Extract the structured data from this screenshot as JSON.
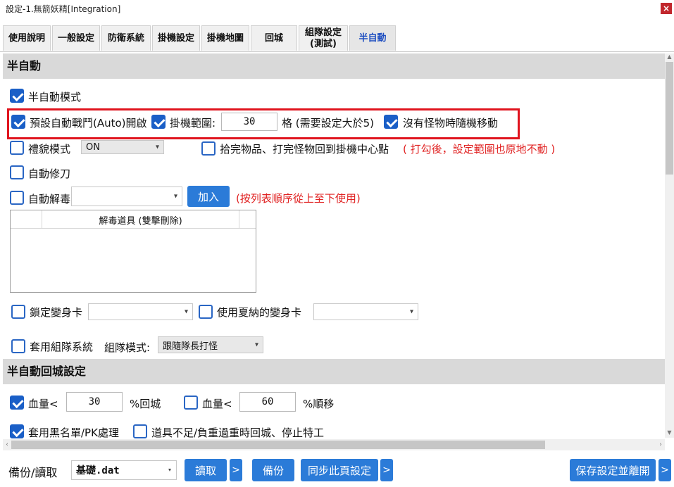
{
  "window": {
    "title": "設定-1.無箭妖精[Integration]",
    "close_icon": "close-icon"
  },
  "tabs": [
    {
      "label": "使用說明"
    },
    {
      "label": "一般設定"
    },
    {
      "label": "防衛系統"
    },
    {
      "label": "掛機設定"
    },
    {
      "label": "掛機地圖"
    },
    {
      "label": "回城"
    },
    {
      "label_line1": "組隊設定",
      "label_line2": "(測試)"
    },
    {
      "label": "半自動",
      "active": true
    }
  ],
  "section1": {
    "title": "半自動",
    "semi_auto_mode": {
      "label": "半自動模式",
      "checked": true
    },
    "auto_battle": {
      "label": "預設自動戰鬥(Auto)開啟",
      "checked": true
    },
    "range": {
      "label": "掛機範圍:",
      "checked": true,
      "value": "30",
      "hint": "格 (需要設定大於5)"
    },
    "random_move": {
      "label": "沒有怪物時隨機移動",
      "checked": true
    },
    "courtesy": {
      "label": "禮貌模式",
      "checked": false,
      "select_value": "ON"
    },
    "return_center": {
      "label": "拾完物品、打完怪物回到掛機中心點",
      "checked": false,
      "note": "( 打勾後，設定範圍也原地不動 )"
    },
    "auto_repair": {
      "label": "自動修刀",
      "checked": false
    },
    "auto_detox": {
      "label": "自動解毒",
      "checked": false,
      "select_value": "",
      "add_button": "加入",
      "note": "(按列表順序從上至下使用)"
    },
    "detox_list": {
      "header": "解毒道具 (雙擊刪除)"
    },
    "lock_transform": {
      "label": "鎖定變身卡",
      "checked": false,
      "select_value": ""
    },
    "use_shana": {
      "label": "使用夏納的變身卡",
      "checked": false,
      "select_value": ""
    },
    "party": {
      "label": "套用組隊系統",
      "checked": false,
      "mode_label": "組隊模式:",
      "mode_value": "跟隨隊長打怪"
    }
  },
  "section2": {
    "title": "半自動回城設定",
    "hp_return": {
      "label": "血量<",
      "checked": true,
      "value": "30",
      "suffix": "%回城"
    },
    "hp_move": {
      "label": "血量<",
      "checked": false,
      "value": "60",
      "suffix": "%順移"
    },
    "blacklist": {
      "label": "套用黑名單/PK處理",
      "checked": true
    },
    "item_shortage": {
      "label": "道具不足/負重過重時回城、停止特工",
      "checked": false
    }
  },
  "bottom": {
    "backup_label": "備份/讀取",
    "file_value": "基礎.dat",
    "read_button": "讀取",
    "backup_button": "備份",
    "sync_button": "同步此頁設定",
    "save_button": "保存設定並離開",
    "arrow": ">"
  },
  "colors": {
    "accent": "#2b7bd8",
    "highlight": "#e0141e",
    "note_red": "#e02020"
  }
}
